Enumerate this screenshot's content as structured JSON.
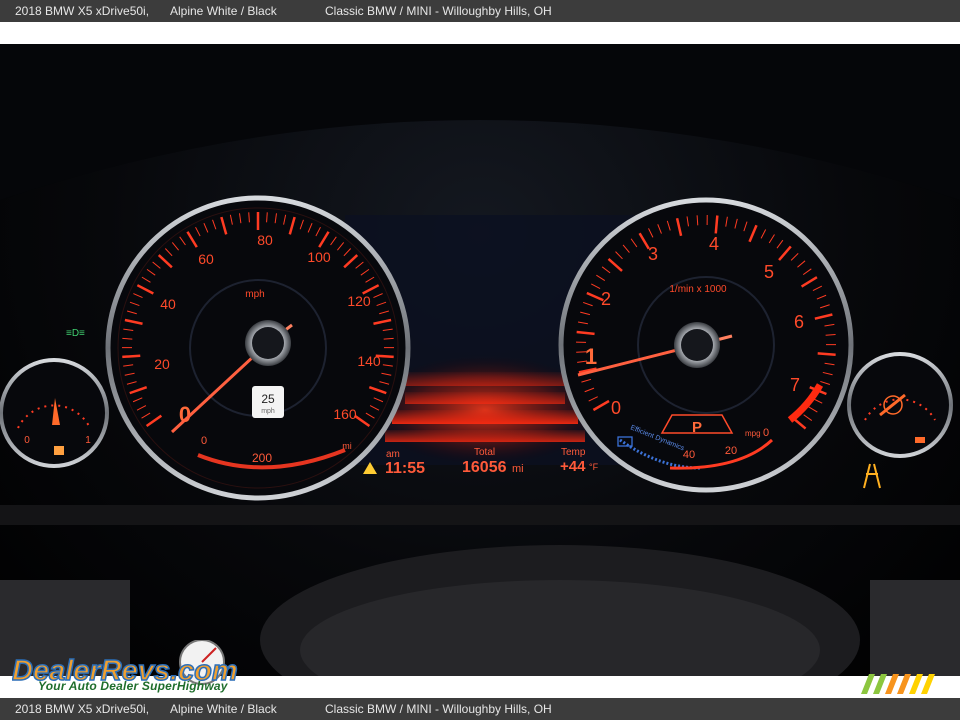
{
  "caption": {
    "vehicle": "2018 BMW X5 xDrive50i,",
    "color": "Alpine White / Black",
    "dealer": "Classic BMW / MINI - Willoughby Hills, OH"
  },
  "cluster": {
    "speedometer": {
      "unit": "mph",
      "ticks": [
        "0",
        "20",
        "40",
        "60",
        "80",
        "100",
        "120",
        "140",
        "160"
      ],
      "speed_limit_value": "25",
      "speed_limit_unit": "mph",
      "range_labels": [
        "0",
        "200",
        "mi"
      ],
      "needle_mph": 0
    },
    "tachometer": {
      "unit": "1/min x 1000",
      "ticks": [
        "0",
        "1",
        "2",
        "3",
        "4",
        "5",
        "6",
        "7"
      ],
      "gear": "P",
      "eff_label": "Efficient Dynamics",
      "mpg_label": "mpg",
      "mpg_ticks": [
        "40",
        "20",
        "0"
      ],
      "needle_rpm_x1000": 1
    },
    "fuel_gauge": {
      "left": "0",
      "right": "1"
    },
    "center_display": {
      "time_label": "am",
      "time_value": "11:55",
      "total_label": "Total",
      "odometer_value": "16056",
      "odometer_unit": "mi",
      "temp_label": "Temp",
      "temp_value": "+44",
      "temp_unit": "°F"
    }
  },
  "watermark": {
    "logo_text": "DealerRevs.com",
    "tagline": "Your Auto Dealer SuperHighway"
  },
  "colors": {
    "gauge_red": "#ff3b22",
    "gauge_orange": "#ff6a2a",
    "chrome": "#a9adb4",
    "efficiency_blue": "#3b72d8"
  }
}
